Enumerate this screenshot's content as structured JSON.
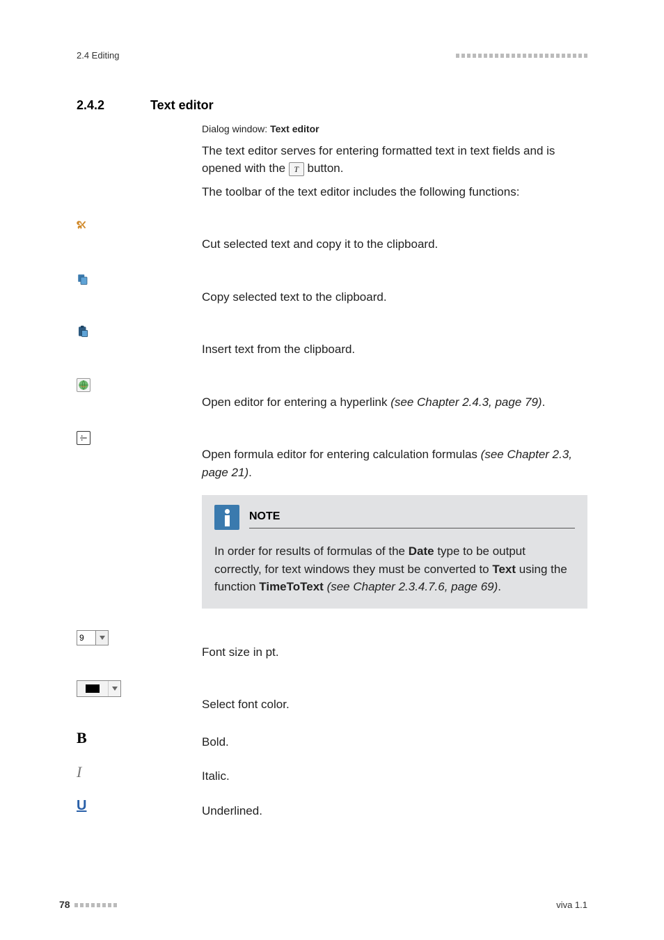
{
  "header": {
    "breadcrumb": "2.4 Editing"
  },
  "section": {
    "number": "2.4.2",
    "title": "Text editor"
  },
  "dialog": {
    "prefix": "Dialog window: ",
    "name": "Text editor"
  },
  "intro": {
    "p1a": "The text editor serves for entering formatted text in text fields and is",
    "p1b_pre": "opened with the ",
    "p1b_btn": "T",
    "p1b_post": " button.",
    "p2": "The toolbar of the text editor includes the following functions:"
  },
  "items": {
    "cut": "Cut selected text and copy it to the clipboard.",
    "copy": "Copy selected text to the clipboard.",
    "paste": "Insert text from the clipboard.",
    "link_pre": "Open editor for entering a hyperlink ",
    "link_ref": "(see Chapter 2.4.3, page 79)",
    "link_post": ".",
    "formula_pre": "Open formula editor for entering calculation formulas ",
    "formula_ref": "(see Chapter 2.3, page 21)",
    "formula_post": ".",
    "fontsize": "Font size in pt.",
    "fontcolor": "Select font color.",
    "bold": "Bold.",
    "italic": "Italic.",
    "underline": "Underlined."
  },
  "controls": {
    "fontsize_value": "9"
  },
  "note": {
    "title": "NOTE",
    "b1": "In order for results of formulas of the ",
    "b2": "Date",
    "b3": " type to be output correctly, for text windows they must be converted to ",
    "b4": "Text",
    "b5": " using the function ",
    "b6": "TimeToText",
    "b7": " (see Chapter 2.3.4.7.6, page 69)",
    "b8": "."
  },
  "footer": {
    "page": "78",
    "product": "viva 1.1"
  }
}
